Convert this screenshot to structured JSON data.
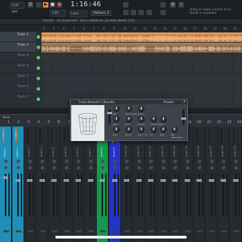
{
  "toolbar": {
    "cpu_display": "118 sec",
    "time": "1:16:46",
    "tempo_display": "130",
    "line_mode": "Line",
    "pattern": "Pattern 1",
    "news": "Today  A newer version of FL Studio is available"
  },
  "playlist": {
    "title": "Playlist · Arrangement · Bars_Albatross_Eusebio Beats 110 ›",
    "ruler": [
      "2",
      "3",
      "4",
      "5",
      "6",
      "7",
      "8",
      "9",
      "10",
      "11",
      "12",
      "13",
      "14",
      "15",
      "16",
      "17",
      "18",
      "19",
      "20",
      "21"
    ],
    "tracks": [
      "Track 1",
      "Track 2",
      "Track 3",
      "Track 4",
      "Track 5",
      "Track 6",
      "Track 7"
    ]
  },
  "plugin": {
    "title": "Fruity Reeverb 2 (Reverb)",
    "presets_label": "Presets",
    "close": "×",
    "knob_labels": [
      "MID",
      "LOW",
      "HIGH",
      "ROOM SIZE",
      "DIFF",
      "DELAY",
      "DECAY",
      "COLOR",
      "HIGH CUT",
      "LOW CUT",
      "DRY",
      "ER",
      "WET",
      "SEP"
    ],
    "brand": "REEVERB 2"
  },
  "mixer": {
    "title": "Mixer",
    "numbers": [
      "1",
      "2",
      "3",
      "4",
      "5",
      "6",
      "7",
      "8",
      "9",
      "10",
      "11",
      "12",
      "13",
      "14",
      "15",
      "16",
      "17",
      "18",
      "19",
      "20",
      "21",
      "22",
      "23",
      "24"
    ],
    "strips": [
      "Master",
      "Insert 1",
      "Insert 2",
      "Insert 3",
      "Insert 4",
      "Insert 5",
      "Insert 6",
      "Insert 7",
      "Insert 8",
      "Insert 9",
      "Insert 10",
      "Insert 11",
      "Insert 12",
      "Insert 13",
      "Insert 14",
      "Insert 15",
      "Insert 16",
      "Insert 17",
      "Insert 18",
      "Insert 19"
    ]
  },
  "colors": {
    "clip": "#c97a35",
    "accent_orange": "#f08a24",
    "strip_cyan": "#1f8fb8",
    "strip_green": "#149a4e",
    "strip_blue": "#2433c8"
  }
}
